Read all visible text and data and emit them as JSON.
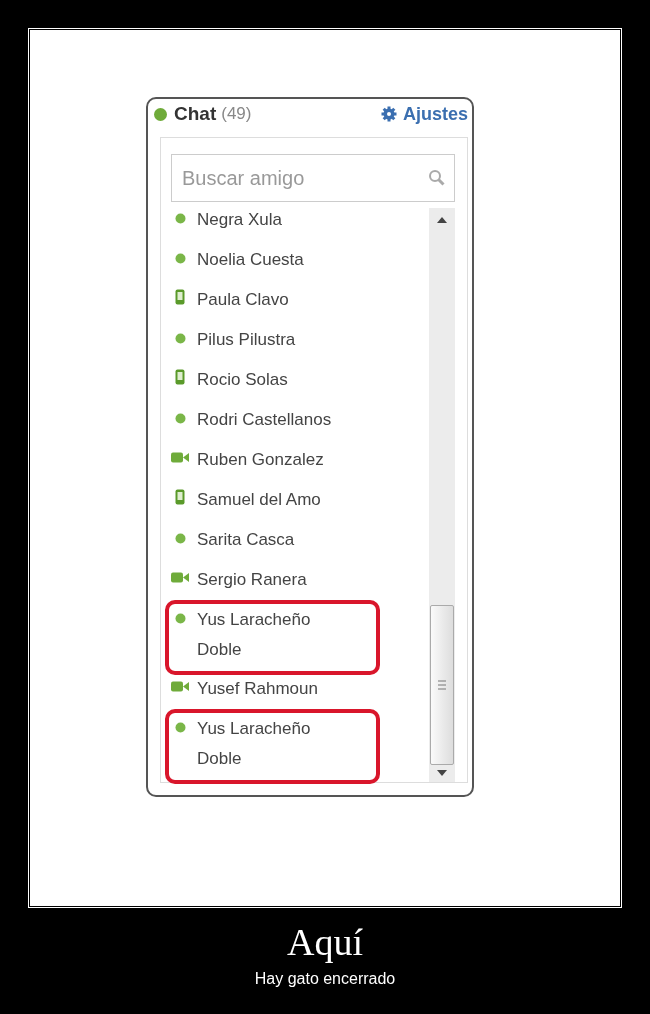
{
  "chat": {
    "title": "Chat",
    "count": "(49)",
    "settings": "Ajustes",
    "search": {
      "placeholder": "Buscar amigo"
    },
    "friends": [
      {
        "name": "Negra Xula",
        "kind": "online",
        "highlighted": false
      },
      {
        "name": "Noelia Cuesta",
        "kind": "online",
        "highlighted": false
      },
      {
        "name": "Paula Clavo",
        "kind": "mobile",
        "highlighted": false
      },
      {
        "name": "Pilus Pilustra",
        "kind": "online",
        "highlighted": false
      },
      {
        "name": "Rocio Solas",
        "kind": "mobile",
        "highlighted": false
      },
      {
        "name": "Rodri Castellanos",
        "kind": "online",
        "highlighted": false
      },
      {
        "name": "Ruben Gonzalez",
        "kind": "video",
        "highlighted": false
      },
      {
        "name": "Samuel del Amo",
        "kind": "mobile",
        "highlighted": false
      },
      {
        "name": "Sarita Casca",
        "kind": "online",
        "highlighted": false
      },
      {
        "name": "Sergio Ranera",
        "kind": "video",
        "highlighted": false
      },
      {
        "name": "Yus Laracheño Doble",
        "kind": "online",
        "highlighted": true
      },
      {
        "name": "Yusef Rahmoun",
        "kind": "video",
        "highlighted": false
      },
      {
        "name": "Yus Laracheño Doble",
        "kind": "online",
        "highlighted": true
      }
    ]
  },
  "caption": {
    "title": "Aquí",
    "subtitle": "Hay gato encerrado"
  }
}
